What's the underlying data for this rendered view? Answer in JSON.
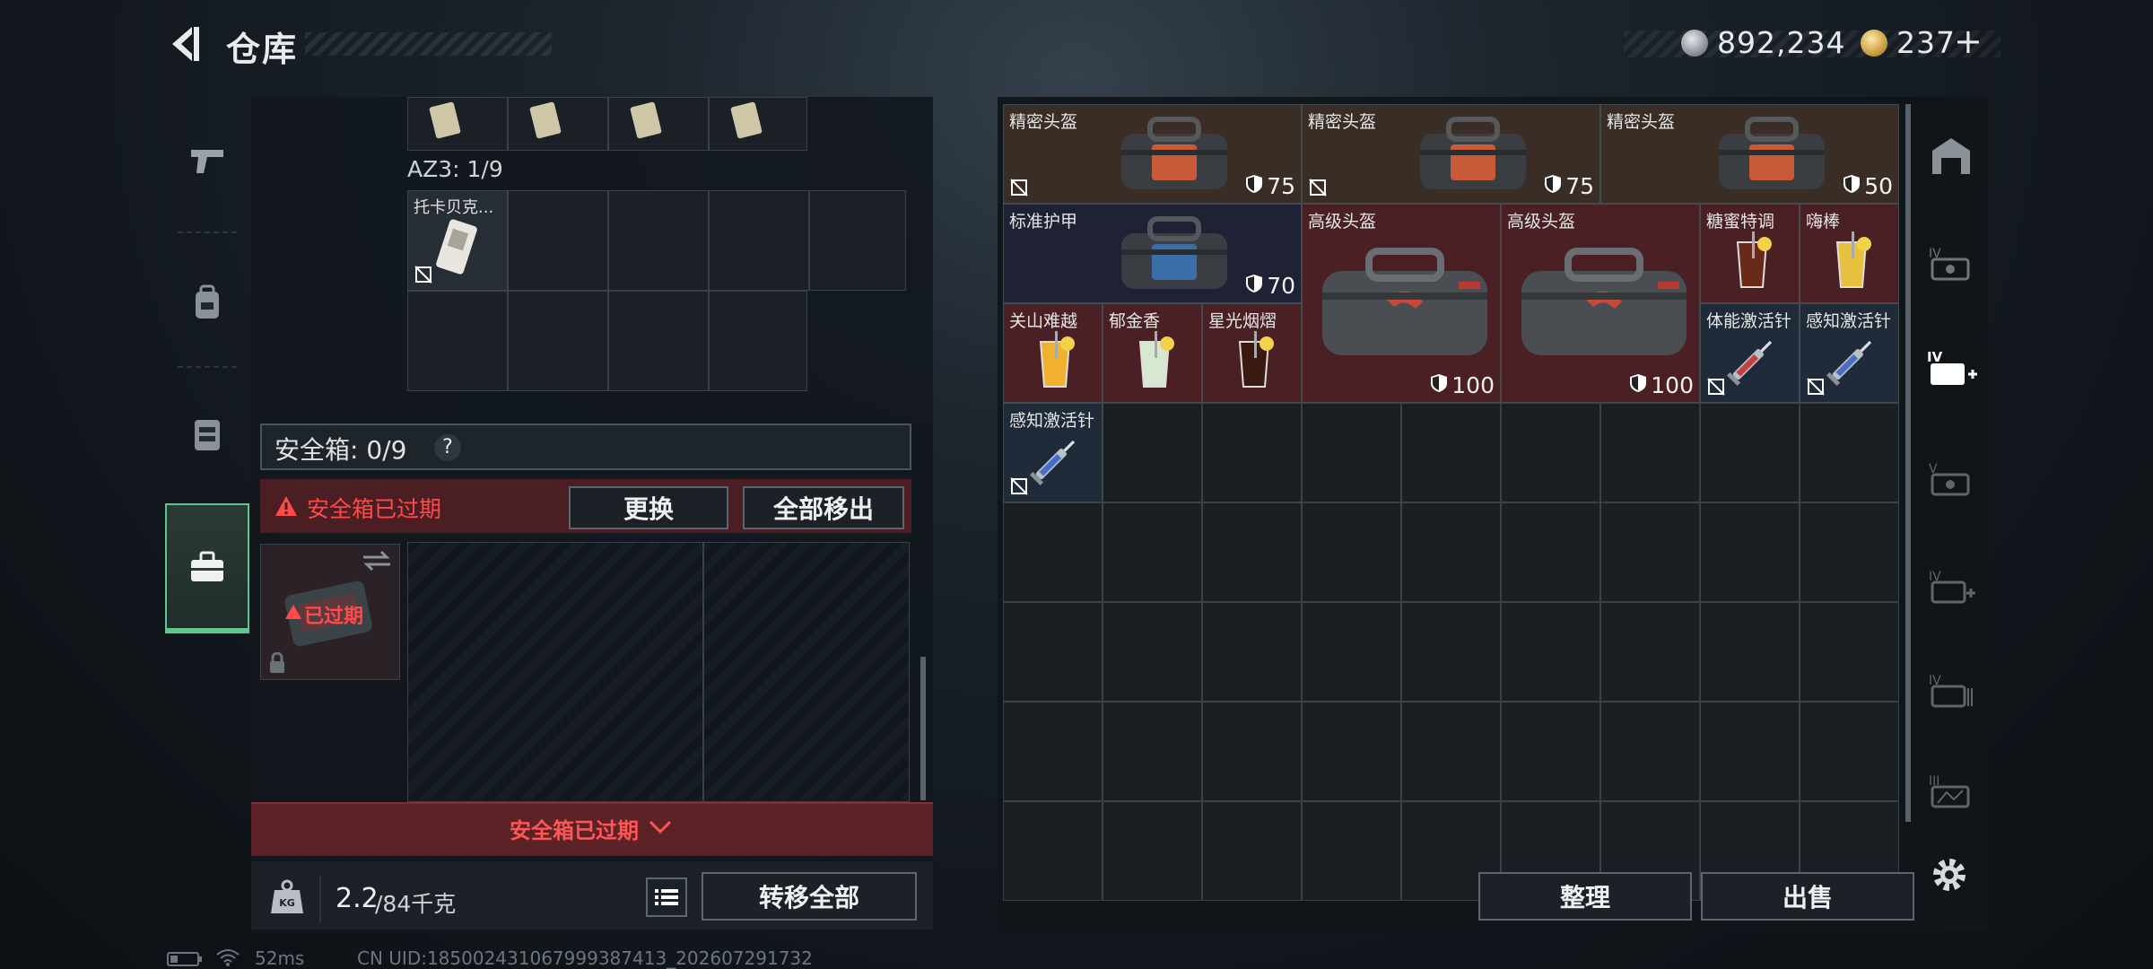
{
  "header": {
    "title": "仓库"
  },
  "currency": {
    "silver": "892,234",
    "gold": "237",
    "add_symbol": "+"
  },
  "left_panel": {
    "az3_label": "AZ3: 1/9",
    "az3_item_name": "托卡贝克...",
    "safe_box_label": "安全箱: 0/9",
    "safe_box_help": "?",
    "expired_notice": "安全箱已过期",
    "replace_button": "更换",
    "remove_all_button": "全部移出",
    "case_expired_label": "已过期",
    "bottom_expired": "安全箱已过期",
    "weight_current": "2.2",
    "weight_max": "/84千克",
    "weight_badge": "KG",
    "transfer_all_button": "转移全部"
  },
  "right_panel": {
    "items": [
      {
        "name": "精密头盔",
        "durability": "75",
        "style": "brown",
        "icon": "bag-icon",
        "no_sell": true
      },
      {
        "name": "精密头盔",
        "durability": "75",
        "style": "brown",
        "icon": "bag-icon",
        "no_sell": true
      },
      {
        "name": "精密头盔",
        "durability": "50",
        "style": "brown",
        "icon": "bag-icon",
        "no_sell": false
      },
      {
        "name": "标准护甲",
        "durability": "70",
        "style": "navy",
        "icon": "bag-blue-icon",
        "no_sell": false
      },
      {
        "name": "高级头盔",
        "durability": "100",
        "style": "red",
        "icon": "large-bag-icon",
        "no_sell": false
      },
      {
        "name": "高级头盔",
        "durability": "100",
        "style": "red",
        "icon": "large-bag-icon",
        "no_sell": false
      },
      {
        "name": "糖蜜特调",
        "style": "red",
        "icon": "drink-dark-icon"
      },
      {
        "name": "嗨棒",
        "style": "red",
        "icon": "drink-lemon-icon"
      },
      {
        "name": "关山难越",
        "style": "red",
        "icon": "drink-orange-icon"
      },
      {
        "name": "郁金香",
        "style": "red",
        "icon": "drink-mint-icon"
      },
      {
        "name": "星光烟熠",
        "style": "red",
        "icon": "drink-cola-icon"
      },
      {
        "name": "体能激活针",
        "style": "steel",
        "icon": "syringe-red-icon",
        "no_sell": true
      },
      {
        "name": "感知激活针",
        "style": "steel",
        "icon": "syringe-blue-icon",
        "no_sell": true
      },
      {
        "name": "感知激活针",
        "style": "steel",
        "icon": "syringe-blue-icon",
        "no_sell": true
      }
    ],
    "sort_button": "整理",
    "sell_button": "出售"
  },
  "status": {
    "ping": "52ms",
    "uid": "CN UID:185002431067999387413_202607291732"
  },
  "colors": {
    "accent_green": "#5fc78e",
    "warning_red": "#ff4a4a",
    "panel": "#12181e"
  }
}
